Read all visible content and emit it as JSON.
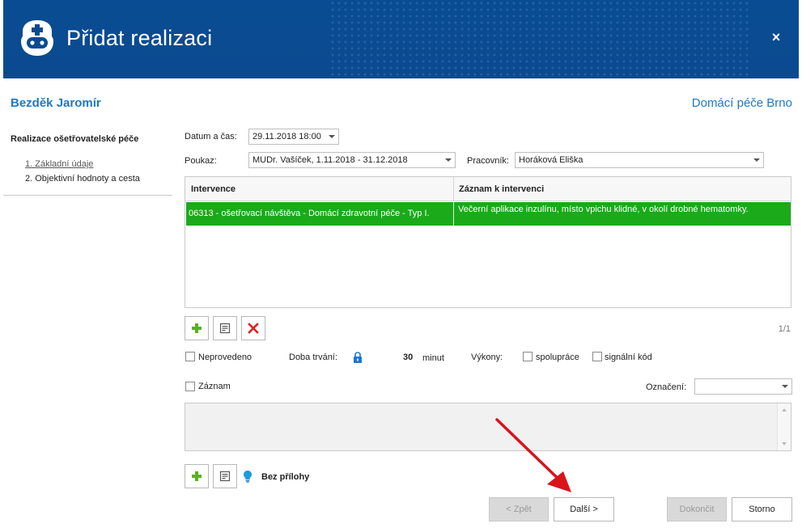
{
  "window": {
    "title": "Přidat realizaci",
    "close_symbol": "×"
  },
  "patient_name": "Bezděk Jaromír",
  "organization": "Domácí péče Brno",
  "sidebar": {
    "title": "Realizace ošetřovatelské péče",
    "steps": [
      "1. Základní údaje",
      "2. Objektivní hodnoty a cesta"
    ]
  },
  "form": {
    "datetime_label": "Datum a čas:",
    "datetime_value": "29.11.2018 18:00",
    "voucher_label": "Poukaz:",
    "voucher_value": "MUDr. Vašíček, 1.11.2018 - 31.12.2018",
    "worker_label": "Pracovník:",
    "worker_value": "Horáková Eliška"
  },
  "grid": {
    "columns": [
      "Intervence",
      "Záznam k intervenci"
    ],
    "rows": [
      {
        "intervention": "06313 - ošetřovací návštěva - Domácí zdravotní péče - Typ I.",
        "note": "Večerní aplikace inzulínu, místo vpichu klidné, v okolí drobné hematomky."
      }
    ],
    "pager": "1/1"
  },
  "options": {
    "not_done_label": "Neprovedeno",
    "duration_label": "Doba trvání:",
    "duration_value": "30",
    "duration_unit": "minut",
    "services_label": "Výkony:",
    "cooperation_label": "spolupráce",
    "signal_code_label": "signální kód",
    "record_label": "Záznam",
    "marking_label": "Označení:",
    "marking_value": ""
  },
  "attachments": {
    "status": "Bez přílohy"
  },
  "buttons": {
    "back": "< Zpět",
    "next": "Další >",
    "finish": "Dokončit",
    "cancel": "Storno"
  },
  "colors": {
    "header": "#0b4a8f",
    "accent": "#1b78c9",
    "selected_row": "#1aaa1a",
    "annotation_arrow": "#d9141b"
  }
}
